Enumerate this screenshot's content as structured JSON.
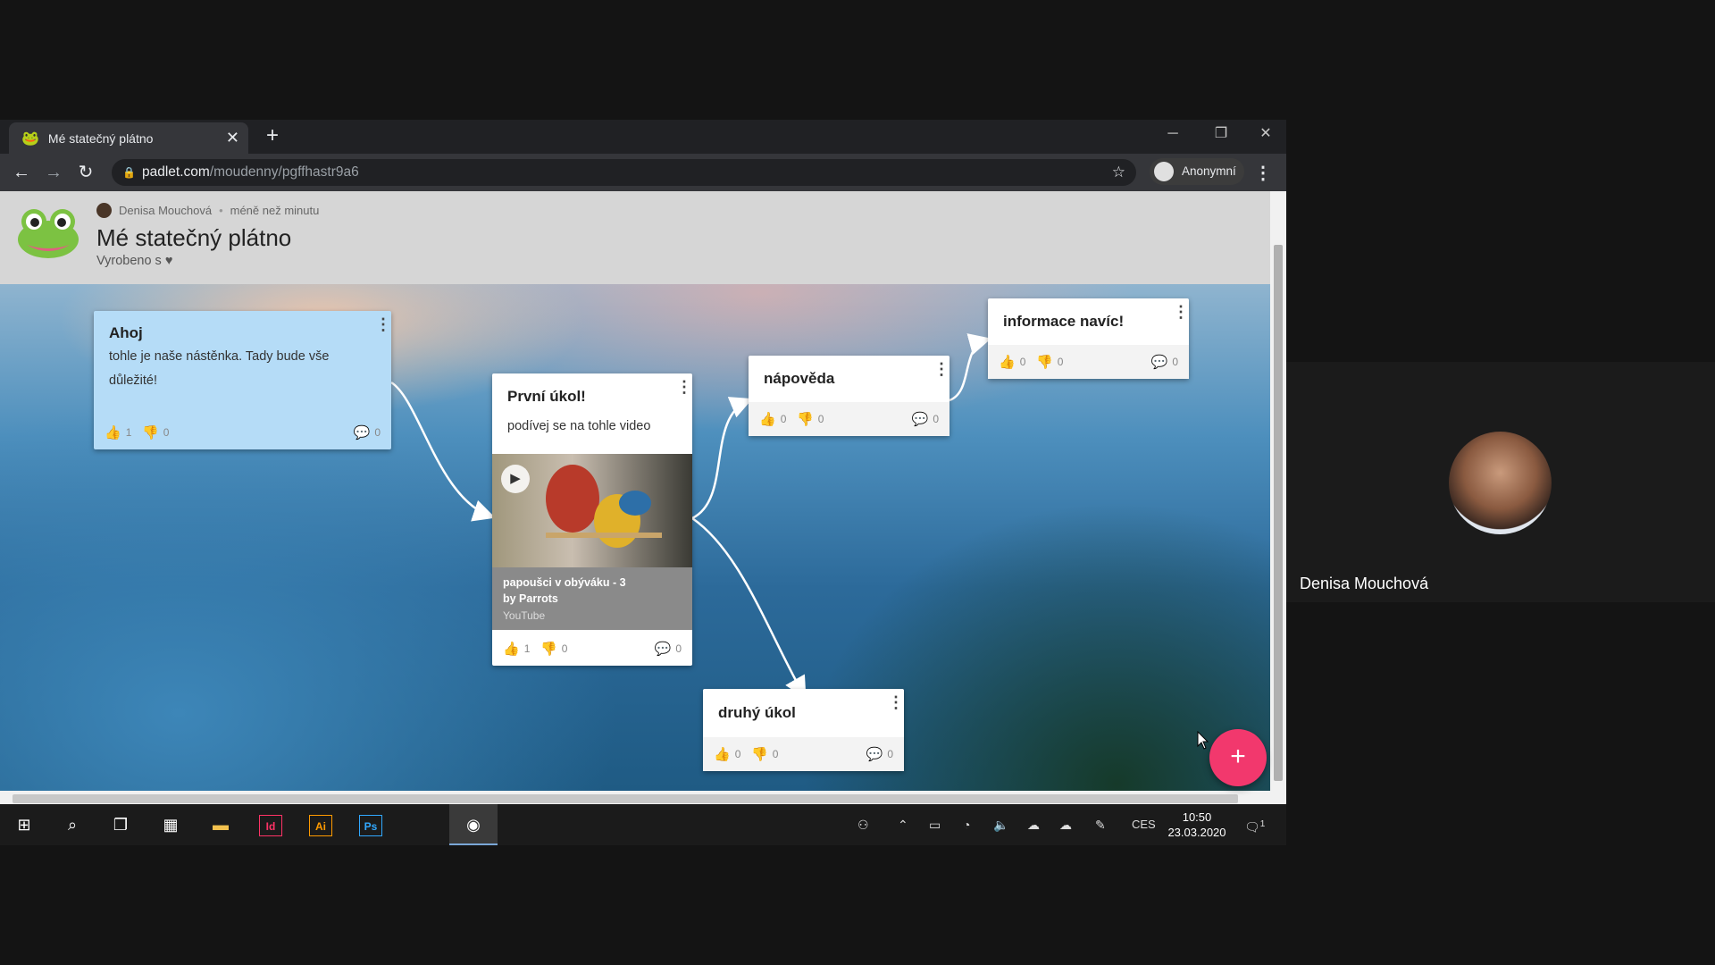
{
  "browser": {
    "tab_title": "Mé statečný plátno",
    "url_domain": "padlet.com",
    "url_path": "/moudenny/pgffhastr9a6",
    "profile_label": "Anonymní"
  },
  "padlet": {
    "author": "Denisa Mouchová",
    "time": "méně než minutu",
    "title": "Mé statečný plátno",
    "made_with": "Vyrobeno s ♥"
  },
  "cards": [
    {
      "title": "Ahoj",
      "body": "tohle je naše nástěnka. Tady bude vše důležité!",
      "likes": "1",
      "dislikes": "0",
      "comments": "0"
    },
    {
      "title": "První úkol!",
      "body": "podívej se na tohle video",
      "video_title": "papoušci v obýváku - 3",
      "video_author": "by Parrots",
      "video_source": "YouTube",
      "likes": "1",
      "dislikes": "0",
      "comments": "0"
    },
    {
      "title": "nápověda",
      "likes": "0",
      "dislikes": "0",
      "comments": "0"
    },
    {
      "title": "informace navíc!",
      "likes": "0",
      "dislikes": "0",
      "comments": "0"
    },
    {
      "title": "druhý úkol",
      "likes": "0",
      "dislikes": "0",
      "comments": "0"
    }
  ],
  "taskbar": {
    "lang": "CES",
    "time": "10:50",
    "date": "23.03.2020",
    "apps": [
      "Id",
      "Ai",
      "Ps"
    ],
    "notification_count": "1"
  },
  "participant": {
    "name": "Denisa Mouchová"
  },
  "colors": {
    "accent_fab": "#f2386d",
    "card_highlight": "#b5dcf7",
    "like_active": "#f05a3a"
  }
}
